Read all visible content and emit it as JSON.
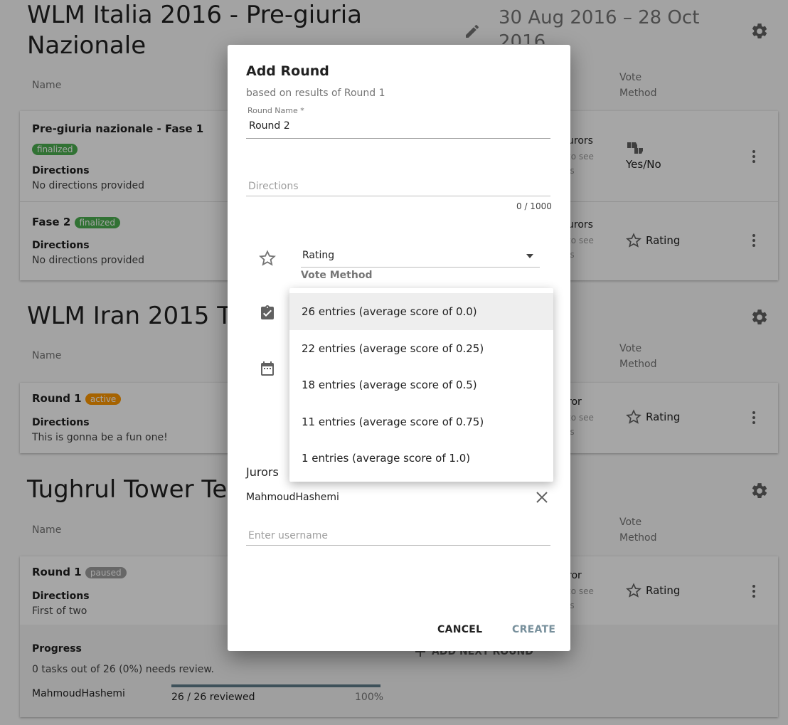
{
  "campaigns": [
    {
      "title_line1": "WLM Italia 2016 - Pre-giuria",
      "title_line2": "Nazionale",
      "date_line1": "30 Aug 2016 – 28 Oct",
      "date_line2": "2016",
      "col_name": "Name",
      "col_vote_1": "Vote",
      "col_vote_2": "Method",
      "rounds": [
        {
          "name": "Pre-giuria nazionale - Fase 1",
          "status": "finalized",
          "directions_label": "Directions",
          "directions": "No directions provided",
          "jurors": "urors",
          "jurors_sub1": "to see",
          "jurors_sub2": "ls",
          "vote_method": "Yes/No"
        },
        {
          "name": "Fase 2",
          "status": "finalized",
          "directions_label": "Directions",
          "directions": "No directions provided",
          "jurors": "urors",
          "jurors_sub1": "to see",
          "jurors_sub2": "ls",
          "vote_method": "Rating"
        }
      ]
    },
    {
      "title": "WLM Iran 2015 Te",
      "col_name": "Name",
      "col_vote_1": "Vote",
      "col_vote_2": "Method",
      "rounds": [
        {
          "name": "Round 1",
          "status": "active",
          "directions_label": "Directions",
          "directions": "This is gonna be a fun one!",
          "jurors": "ror",
          "jurors_sub1": "to see",
          "jurors_sub2": "ls",
          "vote_method": "Rating"
        }
      ]
    },
    {
      "title": "Tughrul Tower Tes",
      "col_name": "Name",
      "col_vote_1": "Vote",
      "col_vote_2": "Method",
      "rounds": [
        {
          "name": "Round 1",
          "status": "paused",
          "directions_label": "Directions",
          "directions": "First of two",
          "jurors": "ror",
          "jurors_sub1": "to see",
          "jurors_sub2": "ls",
          "vote_method": "Rating"
        }
      ],
      "progress": {
        "label": "Progress",
        "summary": "0 tasks out of 26 (0%) needs review.",
        "juror": "MahmoudHashemi",
        "reviewed": "26 / 26 reviewed",
        "percent_label": "100%",
        "fraction": 1.0
      },
      "add_round": "ADD NEXT ROUND"
    }
  ],
  "dialog": {
    "title": "Add Round",
    "subtitle": "based on results of Round 1",
    "round_name_label": "Round Name",
    "round_name_value": "Round 2",
    "directions_placeholder": "Directions",
    "counter": "0 / 1000",
    "vote_method_value": "Rating",
    "vote_method_label": "Vote Method",
    "jurors_heading": "Jurors",
    "juror": "MahmoudHashemi",
    "username_placeholder": "Enter username",
    "cancel": "CANCEL",
    "create": "CREATE",
    "threshold_options": [
      "26 entries (average score of 0.0)",
      "22 entries (average score of 0.25)",
      "18 entries (average score of 0.5)",
      "11 entries (average score of 0.75)",
      "1 entries (average score of 1.0)"
    ]
  },
  "colors": {
    "finalized": "#4caf50",
    "active": "#ff9800",
    "paused": "#9e9e9e",
    "create_disabled": "#78909c"
  },
  "icons": [
    "pencil-icon",
    "gear-icon",
    "more-vert-icon",
    "star-icon",
    "thumbs-icon",
    "clipboard-check-icon",
    "calendar-icon",
    "close-icon",
    "dropdown-arrow-icon",
    "plus-icon"
  ]
}
